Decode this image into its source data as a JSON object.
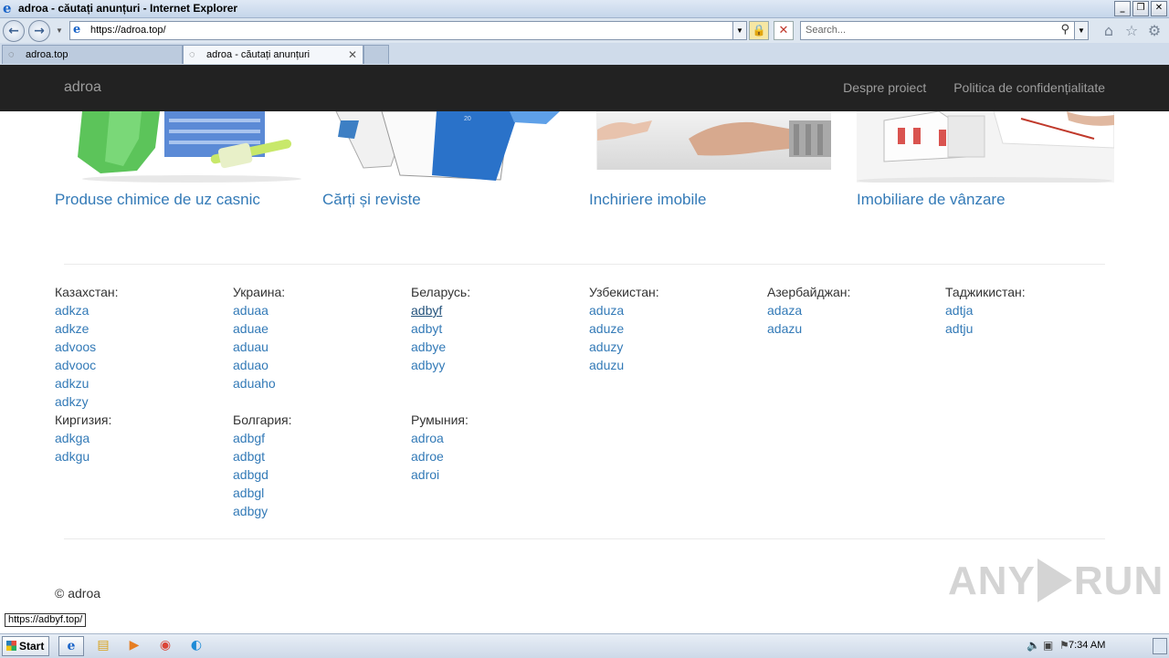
{
  "window": {
    "title": "adroa - căutați anunțuri - Internet Explorer"
  },
  "browser": {
    "address": "https://adroa.top/",
    "search_placeholder": "Search...",
    "tabs": [
      {
        "label": "adroa.top"
      },
      {
        "label": "adroa - căutați anunțuri"
      }
    ],
    "status_url": "https://adbyf.top/"
  },
  "site": {
    "brand": "adroa",
    "nav": [
      "Despre proiect",
      "Politica de confidențialitate"
    ],
    "categories": [
      {
        "name": "Produse chimice de uz casnic"
      },
      {
        "name": "Cărți și reviste"
      },
      {
        "name": "Inchiriere imobile"
      },
      {
        "name": "Imobiliare de vânzare"
      }
    ],
    "countries": [
      {
        "name": "Казахстан:",
        "links": [
          "adkza",
          "adkze",
          "advoos",
          "advooc",
          "adkzu",
          "adkzy"
        ]
      },
      {
        "name": "Украина:",
        "links": [
          "aduaa",
          "aduae",
          "aduau",
          "aduao",
          "aduaho"
        ]
      },
      {
        "name": "Беларусь:",
        "links": [
          "adbyf",
          "adbyt",
          "adbye",
          "adbyy"
        ]
      },
      {
        "name": "Узбекистан:",
        "links": [
          "aduza",
          "aduze",
          "aduzy",
          "aduzu"
        ]
      },
      {
        "name": "Азербайджан:",
        "links": [
          "adaza",
          "adazu"
        ]
      },
      {
        "name": "Таджикистан:",
        "links": [
          "adtja",
          "adtju"
        ]
      },
      {
        "name": "Киргизия:",
        "links": [
          "adkga",
          "adkgu"
        ]
      },
      {
        "name": "Болгария:",
        "links": [
          "adbgf",
          "adbgt",
          "adbgd",
          "adbgl",
          "adbgy"
        ]
      },
      {
        "name": "Румыния:",
        "links": [
          "adroa",
          "adroe",
          "adroi"
        ]
      }
    ],
    "hovered_link": "adbyf",
    "copyright": "© adroa"
  },
  "watermark": {
    "left": "ANY",
    "right": "RUN"
  },
  "taskbar": {
    "start_label": "Start",
    "clock": "7:34 AM"
  }
}
